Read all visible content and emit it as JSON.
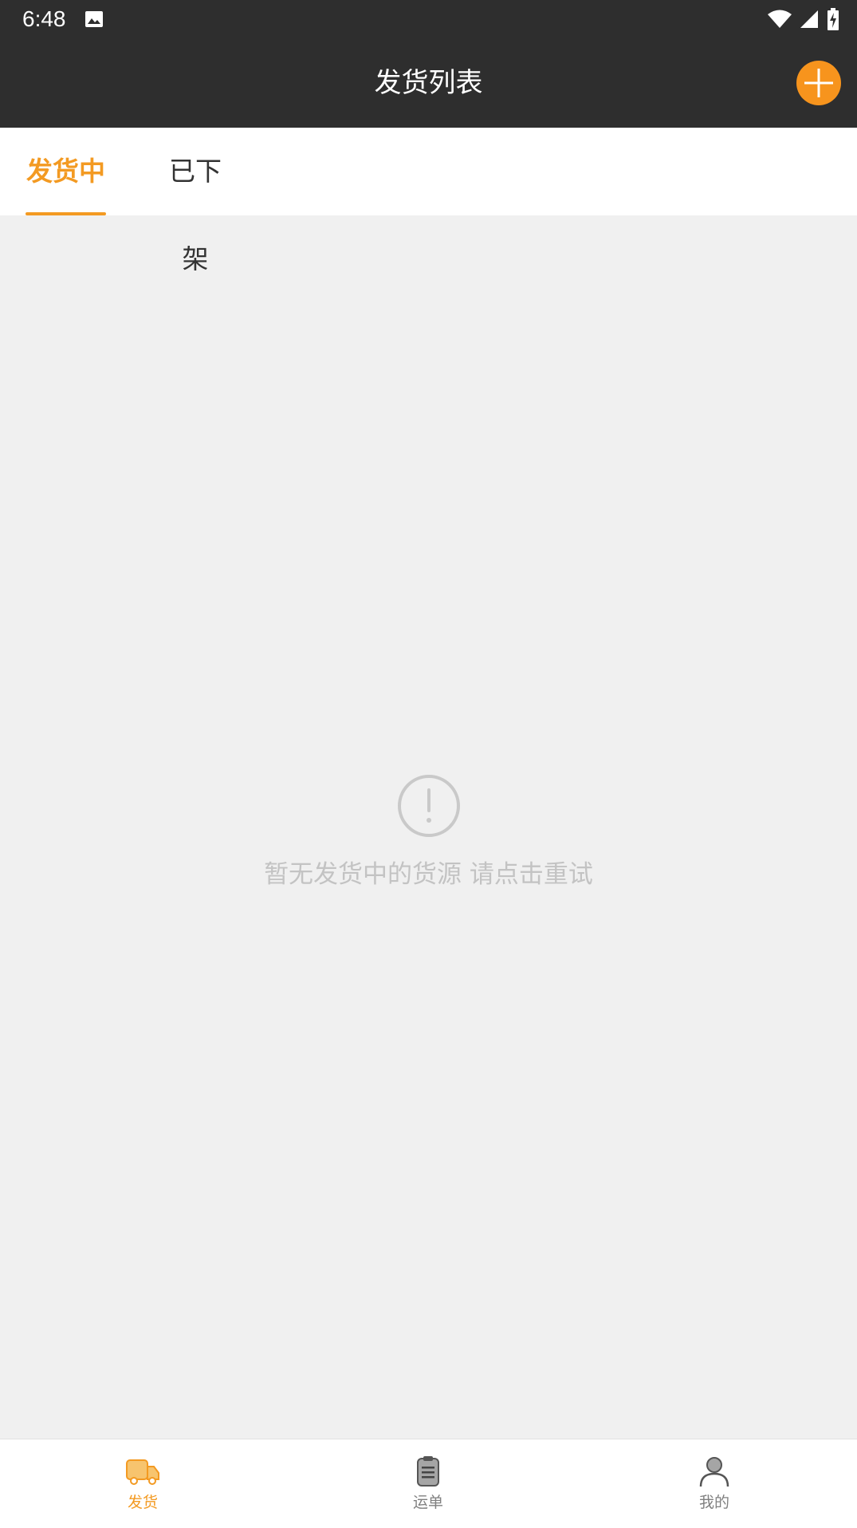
{
  "status_bar": {
    "time": "6:48"
  },
  "app_bar": {
    "title": "发货列表"
  },
  "tabs": [
    {
      "label": "发货中",
      "active": true
    },
    {
      "label": "已下架",
      "active": false
    }
  ],
  "empty_state": {
    "message": "暂无发货中的货源 请点击重试"
  },
  "bottom_nav": [
    {
      "label": "发货",
      "icon": "truck-icon",
      "active": true
    },
    {
      "label": "运单",
      "icon": "clipboard-icon",
      "active": false
    },
    {
      "label": "我的",
      "icon": "person-icon",
      "active": false
    }
  ],
  "colors": {
    "accent": "#f39a22",
    "header_bg": "#2e2e2e",
    "page_bg": "#f0f0f0"
  }
}
